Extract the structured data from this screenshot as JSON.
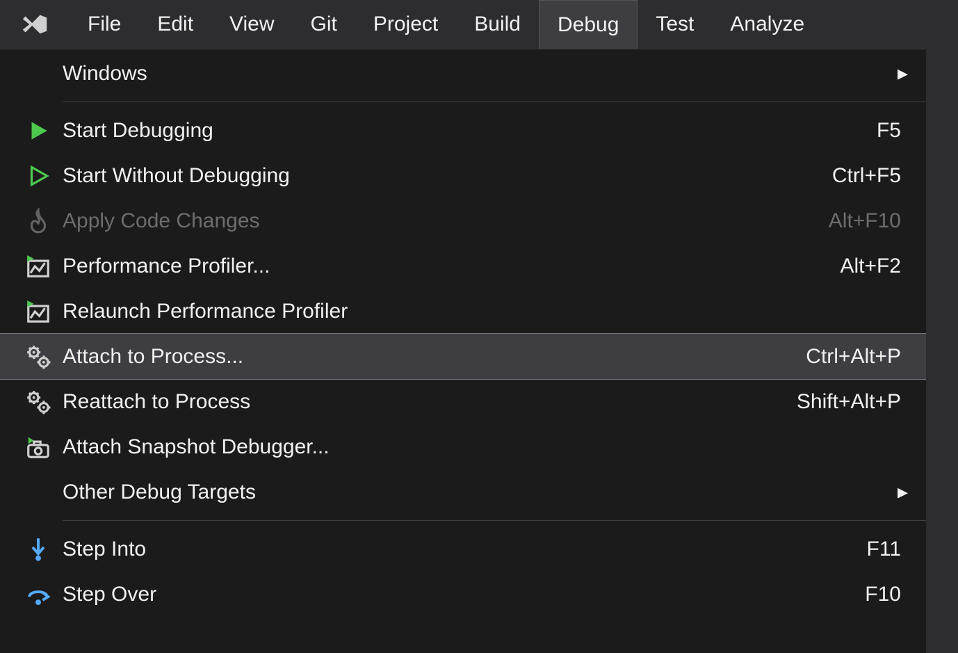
{
  "menubar": {
    "items": [
      "File",
      "Edit",
      "View",
      "Git",
      "Project",
      "Build",
      "Debug",
      "Test",
      "Analyze"
    ],
    "activeIndex": 6
  },
  "dropdown": {
    "items": [
      {
        "type": "item",
        "label": "Windows",
        "submenu": true
      },
      {
        "type": "sep"
      },
      {
        "type": "item",
        "label": "Start Debugging",
        "shortcut": "F5",
        "icon": "play-fill"
      },
      {
        "type": "item",
        "label": "Start Without Debugging",
        "shortcut": "Ctrl+F5",
        "icon": "play-outline"
      },
      {
        "type": "item",
        "label": "Apply Code Changes",
        "shortcut": "Alt+F10",
        "icon": "flame",
        "disabled": true
      },
      {
        "type": "item",
        "label": "Performance Profiler...",
        "shortcut": "Alt+F2",
        "icon": "perf"
      },
      {
        "type": "item",
        "label": "Relaunch Performance Profiler",
        "icon": "perf"
      },
      {
        "type": "item",
        "label": "Attach to Process...",
        "shortcut": "Ctrl+Alt+P",
        "icon": "gears",
        "highlight": true
      },
      {
        "type": "item",
        "label": "Reattach to Process",
        "shortcut": "Shift+Alt+P",
        "icon": "gears"
      },
      {
        "type": "item",
        "label": "Attach Snapshot Debugger...",
        "icon": "camera"
      },
      {
        "type": "item",
        "label": "Other Debug Targets",
        "submenu": true
      },
      {
        "type": "sep"
      },
      {
        "type": "item",
        "label": "Step Into",
        "shortcut": "F11",
        "icon": "step-into"
      },
      {
        "type": "item",
        "label": "Step Over",
        "shortcut": "F10",
        "icon": "step-over"
      }
    ]
  }
}
